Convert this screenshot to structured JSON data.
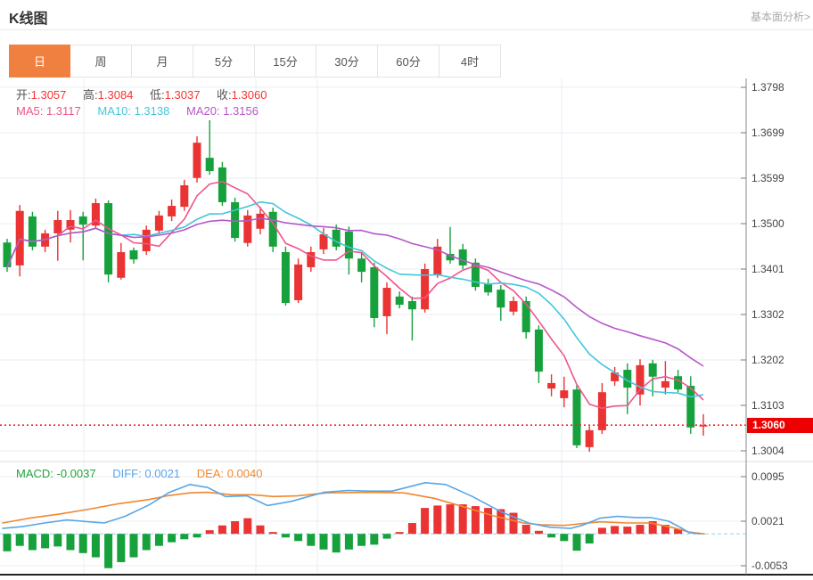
{
  "header": {
    "title": "K线图",
    "link": "基本面分析>"
  },
  "tabs": {
    "items": [
      "日",
      "周",
      "月",
      "5分",
      "15分",
      "30分",
      "60分",
      "4时"
    ],
    "active_index": 0
  },
  "legend": {
    "open_label": "开:",
    "open": "1.3057",
    "high_label": "高:",
    "high": "1.3084",
    "low_label": "低:",
    "low": "1.3037",
    "close_label": "收:",
    "close": "1.3060",
    "ma5_label": "MA5:",
    "ma5": "1.3117",
    "ma10_label": "MA10:",
    "ma10": "1.3138",
    "ma20_label": "MA20:",
    "ma20": "1.3156"
  },
  "macd_legend": {
    "macd_label": "MACD:",
    "macd": "-0.0037",
    "diff_label": "DIFF:",
    "diff": "0.0021",
    "dea_label": "DEA:",
    "dea": "0.0040"
  },
  "price_line": {
    "value": 1.306,
    "label": "1.3060"
  },
  "colors": {
    "up": "#ea3333",
    "down": "#16a13c",
    "ma5": "#f0548b",
    "ma10": "#43c6db",
    "ma20": "#b558c8",
    "diff": "#58a6e8",
    "dea": "#f0882e",
    "macd_text": "#22a438",
    "value_red": "#f53333",
    "label_gray": "#555555",
    "tab_active": "#f08040",
    "link_gray": "#a9a9a9",
    "grid": "#e9eef5",
    "zero_dash": "#8fd3ef",
    "price_dash": "#f32626",
    "tag_bg": "#ee0000",
    "axis_border": "#888888",
    "separator": "#dddddd",
    "bottom_line": "#222222"
  },
  "chart_data": {
    "type": "candlestick",
    "title": "K线图 日线 (daily K-line with MA5/MA10/MA20 and MACD)",
    "panels": [
      {
        "name": "price",
        "y_tick_labels": [
          "1.3798",
          "1.3699",
          "1.3599",
          "1.3500",
          "1.3401",
          "1.3302",
          "1.3202",
          "1.3103",
          "1.3004"
        ],
        "y_ticks": [
          1.3798,
          1.3699,
          1.3599,
          1.35,
          1.3401,
          1.3302,
          1.3202,
          1.3103,
          1.3004
        ],
        "ma_periods": [
          5,
          10,
          20
        ],
        "candles_format": [
          "open",
          "high",
          "low",
          "close"
        ],
        "candles": [
          [
            1.3459,
            1.3467,
            1.3395,
            1.3405
          ],
          [
            1.3409,
            1.3541,
            1.3385,
            1.3528
          ],
          [
            1.3516,
            1.3526,
            1.3442,
            1.345
          ],
          [
            1.345,
            1.3487,
            1.3438,
            1.3479
          ],
          [
            1.3479,
            1.3528,
            1.3419,
            1.3508
          ],
          [
            1.3487,
            1.353,
            1.3459,
            1.3508
          ],
          [
            1.3516,
            1.3526,
            1.342,
            1.3498
          ],
          [
            1.3496,
            1.3555,
            1.3489,
            1.3545
          ],
          [
            1.3545,
            1.3551,
            1.3372,
            1.3389
          ],
          [
            1.3382,
            1.3458,
            1.3378,
            1.3438
          ],
          [
            1.3442,
            1.3448,
            1.3413,
            1.3422
          ],
          [
            1.344,
            1.3496,
            1.3432,
            1.3487
          ],
          [
            1.3485,
            1.3528,
            1.3477,
            1.3518
          ],
          [
            1.3516,
            1.3553,
            1.3506,
            1.3539
          ],
          [
            1.3537,
            1.3596,
            1.3528,
            1.3584
          ],
          [
            1.36,
            1.3691,
            1.359,
            1.3677
          ],
          [
            1.3644,
            1.3726,
            1.3607,
            1.3615
          ],
          [
            1.3623,
            1.3635,
            1.3539,
            1.3547
          ],
          [
            1.3547,
            1.3557,
            1.3461,
            1.3469
          ],
          [
            1.3458,
            1.353,
            1.345,
            1.3518
          ],
          [
            1.3489,
            1.3537,
            1.3477,
            1.3522
          ],
          [
            1.3526,
            1.3535,
            1.3438,
            1.345
          ],
          [
            1.3438,
            1.345,
            1.3321,
            1.3327
          ],
          [
            1.3333,
            1.3424,
            1.3327,
            1.3411
          ],
          [
            1.3405,
            1.345,
            1.3395,
            1.3438
          ],
          [
            1.3444,
            1.3491,
            1.3434,
            1.3477
          ],
          [
            1.3487,
            1.3498,
            1.3442,
            1.345
          ],
          [
            1.3483,
            1.3494,
            1.3389,
            1.3424
          ],
          [
            1.3424,
            1.3436,
            1.3372,
            1.3395
          ],
          [
            1.3405,
            1.3415,
            1.3274,
            1.3294
          ],
          [
            1.3298,
            1.3372,
            1.3259,
            1.336
          ],
          [
            1.3341,
            1.3352,
            1.3315,
            1.3323
          ],
          [
            1.3331,
            1.3341,
            1.3245,
            1.3313
          ],
          [
            1.3313,
            1.3413,
            1.3306,
            1.3401
          ],
          [
            1.3389,
            1.3467,
            1.3382,
            1.345
          ],
          [
            1.3434,
            1.3493,
            1.3413,
            1.342
          ],
          [
            1.3444,
            1.3456,
            1.3401,
            1.3409
          ],
          [
            1.3415,
            1.3424,
            1.3354,
            1.3362
          ],
          [
            1.337,
            1.338,
            1.3343,
            1.335
          ],
          [
            1.3356,
            1.3366,
            1.3288,
            1.3317
          ],
          [
            1.3308,
            1.3341,
            1.33,
            1.3331
          ],
          [
            1.3331,
            1.3341,
            1.3249,
            1.3263
          ],
          [
            1.3269,
            1.3278,
            1.3152,
            1.3177
          ],
          [
            1.314,
            1.3171,
            1.3123,
            1.3152
          ],
          [
            1.3119,
            1.3166,
            1.3099,
            1.3136
          ],
          [
            1.3138,
            1.3148,
            1.301,
            1.3016
          ],
          [
            1.3012,
            1.3058,
            1.3002,
            1.3049
          ],
          [
            1.3049,
            1.3152,
            1.3041,
            1.3132
          ],
          [
            1.3156,
            1.3187,
            1.3146,
            1.3175
          ],
          [
            1.3181,
            1.3195,
            1.3084,
            1.3142
          ],
          [
            1.3127,
            1.3204,
            1.3103,
            1.3191
          ],
          [
            1.3195,
            1.3203,
            1.3123,
            1.3166
          ],
          [
            1.3142,
            1.32,
            1.3127,
            1.3156
          ],
          [
            1.3167,
            1.3181,
            1.3132,
            1.3138
          ],
          [
            1.3146,
            1.3167,
            1.3041,
            1.3055
          ],
          [
            1.3057,
            1.3084,
            1.3037,
            1.306
          ]
        ]
      },
      {
        "name": "macd",
        "y_tick_labels": [
          "0.0095",
          "0.0021",
          "-0.0053"
        ],
        "y_ticks": [
          0.0095,
          0.0021,
          -0.0053
        ],
        "histogram": [
          -0.0029,
          -0.002,
          -0.0027,
          -0.0024,
          -0.0021,
          -0.0027,
          -0.0032,
          -0.0039,
          -0.0057,
          -0.0047,
          -0.0039,
          -0.0027,
          -0.002,
          -0.0014,
          -0.0009,
          -0.0006,
          0.0006,
          0.0014,
          0.0021,
          0.0026,
          0.0014,
          0.0003,
          -0.0006,
          -0.0012,
          -0.002,
          -0.0026,
          -0.0031,
          -0.0026,
          -0.002,
          -0.0018,
          -0.0008,
          0.0003,
          0.0018,
          0.0043,
          0.0047,
          0.0049,
          0.0049,
          0.0046,
          0.0043,
          0.0041,
          0.0035,
          0.0015,
          0.0005,
          -0.0006,
          -0.0012,
          -0.0028,
          -0.0016,
          0.001,
          0.0013,
          0.0012,
          0.0015,
          0.0021,
          0.0015,
          0.0008
        ],
        "diff_points": [
          [
            3,
            0.0009
          ],
          [
            25,
            0.0012
          ],
          [
            50,
            0.0018
          ],
          [
            75,
            0.0023
          ],
          [
            100,
            0.002
          ],
          [
            117,
            0.0018
          ],
          [
            140,
            0.0029
          ],
          [
            167,
            0.0048
          ],
          [
            190,
            0.0069
          ],
          [
            213,
            0.0082
          ],
          [
            233,
            0.0077
          ],
          [
            253,
            0.0062
          ],
          [
            277,
            0.0063
          ],
          [
            300,
            0.0047
          ],
          [
            327,
            0.0054
          ],
          [
            363,
            0.0069
          ],
          [
            390,
            0.0072
          ],
          [
            413,
            0.0071
          ],
          [
            440,
            0.0071
          ],
          [
            477,
            0.0085
          ],
          [
            500,
            0.0082
          ],
          [
            530,
            0.0062
          ],
          [
            563,
            0.0036
          ],
          [
            593,
            0.0018
          ],
          [
            617,
            0.0011
          ],
          [
            640,
            0.0009
          ],
          [
            653,
            0.0014
          ],
          [
            673,
            0.0026
          ],
          [
            693,
            0.0029
          ],
          [
            713,
            0.0027
          ],
          [
            730,
            0.0027
          ],
          [
            750,
            0.0021
          ],
          [
            763,
            0.0011
          ],
          [
            773,
            0.0002
          ],
          [
            785,
            0.0
          ]
        ],
        "dea_points": [
          [
            3,
            0.0018
          ],
          [
            33,
            0.0026
          ],
          [
            67,
            0.0033
          ],
          [
            100,
            0.0041
          ],
          [
            133,
            0.005
          ],
          [
            167,
            0.0057
          ],
          [
            187,
            0.0063
          ],
          [
            213,
            0.0068
          ],
          [
            233,
            0.0069
          ],
          [
            260,
            0.0065
          ],
          [
            283,
            0.0065
          ],
          [
            307,
            0.0062
          ],
          [
            333,
            0.0063
          ],
          [
            367,
            0.0068
          ],
          [
            413,
            0.0069
          ],
          [
            453,
            0.0068
          ],
          [
            487,
            0.0059
          ],
          [
            520,
            0.0045
          ],
          [
            553,
            0.003
          ],
          [
            587,
            0.0018
          ],
          [
            607,
            0.0015
          ],
          [
            633,
            0.0014
          ],
          [
            653,
            0.0017
          ],
          [
            673,
            0.002
          ],
          [
            703,
            0.0018
          ],
          [
            730,
            0.0018
          ],
          [
            753,
            0.0011
          ],
          [
            773,
            0.0003
          ],
          [
            790,
            0.0
          ]
        ]
      }
    ]
  }
}
